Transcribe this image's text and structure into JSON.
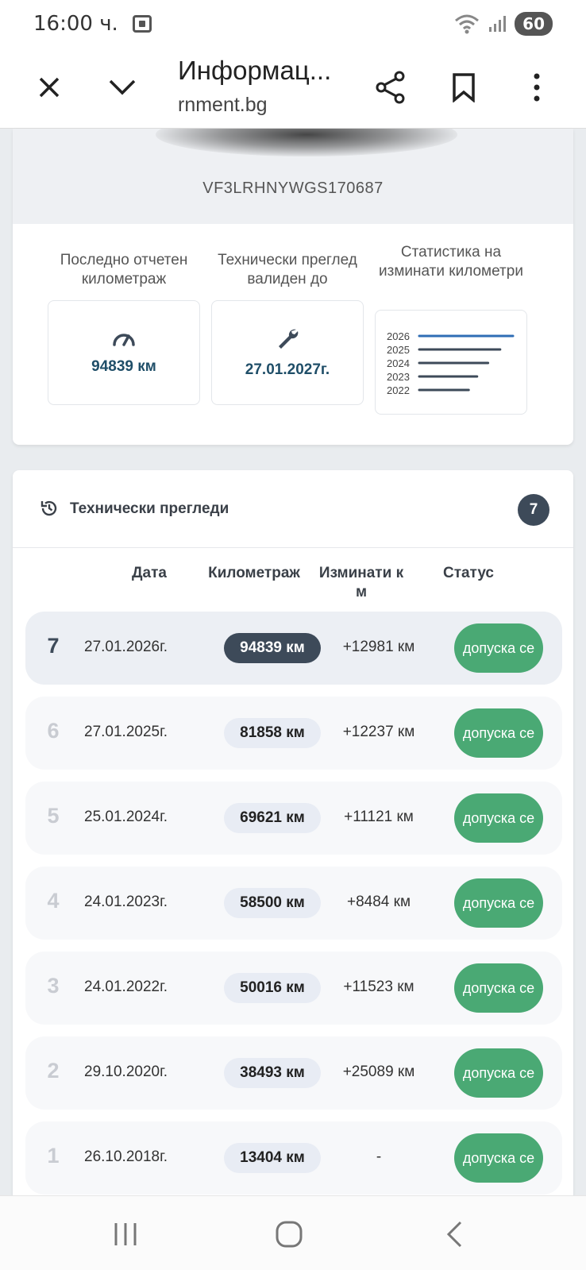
{
  "status_bar": {
    "time": "16:00 ч.",
    "battery": "60",
    "icons": [
      "screenshot-icon",
      "wifi-icon",
      "signal-icon"
    ]
  },
  "browser": {
    "title": "Информац...",
    "url": "rnment.bg",
    "icons": [
      "close-icon",
      "chevron-down-icon",
      "share-icon",
      "bookmark-icon",
      "more-vert-icon"
    ]
  },
  "vehicle": {
    "vin": "VF3LRHNYWGS170687"
  },
  "stats": {
    "mileage_label": "Последно отчетен километраж",
    "mileage_value": "94839 км",
    "inspection_label": "Технически преглед валиден до",
    "inspection_value": "27.01.2027г.",
    "chart_label": "Статистика на изминати километри"
  },
  "chart_data": {
    "type": "bar",
    "orientation": "horizontal",
    "categories": [
      "2026",
      "2025",
      "2024",
      "2023",
      "2022"
    ],
    "values": [
      94839,
      81858,
      69621,
      58500,
      50016
    ],
    "highlight_color": "#2f6db5",
    "bar_color": "#3d4a59"
  },
  "inspections": {
    "title": "Технически прегледи",
    "count": "7",
    "columns": [
      "Дата",
      "Километраж",
      "Изминати к м",
      "Статус"
    ],
    "rows": [
      {
        "num": "7",
        "date": "27.01.2026г.",
        "km": "94839 км",
        "diff": "+12981 км",
        "status": "допуска се",
        "active": true
      },
      {
        "num": "6",
        "date": "27.01.2025г.",
        "km": "81858 км",
        "diff": "+12237 км",
        "status": "допуска се"
      },
      {
        "num": "5",
        "date": "25.01.2024г.",
        "km": "69621 км",
        "diff": "+11121 км",
        "status": "допуска се"
      },
      {
        "num": "4",
        "date": "24.01.2023г.",
        "km": "58500 км",
        "diff": "+8484 км",
        "status": "допуска се"
      },
      {
        "num": "3",
        "date": "24.01.2022г.",
        "km": "50016 км",
        "diff": "+11523 км",
        "status": "допуска се"
      },
      {
        "num": "2",
        "date": "29.10.2020г.",
        "km": "38493 км",
        "diff": "+25089 км",
        "status": "допуска се"
      },
      {
        "num": "1",
        "date": "26.10.2018г.",
        "km": "13404 км",
        "diff": "-",
        "status": "допуска се"
      }
    ],
    "status_color": "#4aa974"
  },
  "nav": {
    "icons": [
      "recent-apps-icon",
      "home-icon",
      "back-icon"
    ]
  }
}
